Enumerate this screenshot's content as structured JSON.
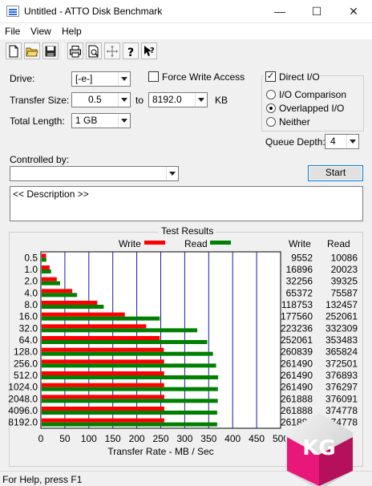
{
  "window": {
    "title": "Untitled - ATTO Disk Benchmark",
    "minimize": "—",
    "maximize": "☐",
    "close": "✕"
  },
  "menu": [
    "File",
    "View",
    "Help"
  ],
  "toolbar": [
    "new-icon",
    "open-icon",
    "save-icon",
    "print-icon",
    "print-preview-icon",
    "move-icon",
    "help-icon",
    "context-help-icon"
  ],
  "settings": {
    "drive_label": "Drive:",
    "drive_value": "[-e-]",
    "transfer_size_label": "Transfer Size:",
    "transfer_from": "0.5",
    "to_label": "to",
    "transfer_to": "8192.0",
    "kb_label": "KB",
    "total_length_label": "Total Length:",
    "total_length_value": "1 GB",
    "force_write_label": "Force Write Access",
    "force_write_checked": false,
    "direct_io_label": "Direct I/O",
    "direct_io_checked": true,
    "io_comparison_label": "I/O Comparison",
    "overlapped_io_label": "Overlapped I/O",
    "neither_label": "Neither",
    "selected_mode": "Overlapped I/O",
    "queue_depth_label": "Queue Depth:",
    "queue_depth_value": "4",
    "controlled_by_label": "Controlled by:",
    "controlled_by_value": "",
    "start_label": "Start",
    "description": "<< Description >>"
  },
  "results": {
    "title": "Test Results",
    "write_legend": "Write",
    "read_legend": "Read",
    "write_col": "Write",
    "read_col": "Read"
  },
  "chart_data": {
    "type": "bar",
    "orientation": "horizontal",
    "xlabel": "Transfer Rate - MB / Sec",
    "xlim": [
      0,
      500
    ],
    "xticks": [
      "0",
      "50",
      "100",
      "150",
      "200",
      "250",
      "300",
      "350",
      "400",
      "450",
      "500"
    ],
    "grid": true,
    "categories": [
      "0.5",
      "1.0",
      "2.0",
      "4.0",
      "8.0",
      "16.0",
      "32.0",
      "64.0",
      "128.0",
      "256.0",
      "512.0",
      "1024.0",
      "2048.0",
      "4096.0",
      "8192.0"
    ],
    "series": [
      {
        "name": "Write",
        "color": "#ff0000",
        "values": [
          9.3,
          16.5,
          31.5,
          63.8,
          116.0,
          173.4,
          218.0,
          246.2,
          254.7,
          255.4,
          255.4,
          255.4,
          255.7,
          255.7,
          255.7
        ],
        "labels": [
          "9552",
          "16896",
          "32256",
          "65372",
          "118753",
          "177560",
          "223236",
          "252061",
          "260839",
          "261490",
          "261490",
          "261490",
          "261888",
          "261888",
          "261888"
        ]
      },
      {
        "name": "Read",
        "color": "#008000",
        "values": [
          9.8,
          19.6,
          38.4,
          73.8,
          129.4,
          246.2,
          324.5,
          345.2,
          357.2,
          363.8,
          368.1,
          367.5,
          367.3,
          366.0,
          366.0
        ],
        "labels": [
          "10086",
          "20023",
          "39325",
          "75587",
          "132457",
          "252061",
          "332309",
          "353483",
          "365824",
          "372501",
          "376893",
          "376297",
          "376091",
          "374778",
          "374778"
        ]
      }
    ]
  },
  "status": "For Help, press F1",
  "logo_text": "KG",
  "colors": {
    "write": "#ff0000",
    "read": "#008000",
    "accent": "#0078d7"
  }
}
